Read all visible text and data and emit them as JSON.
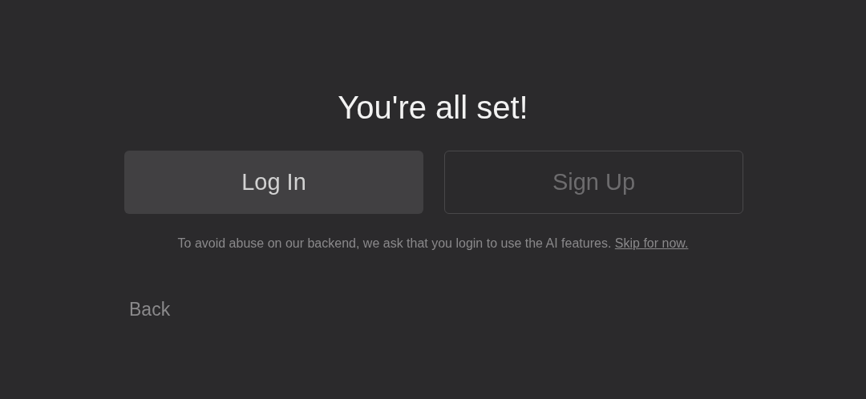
{
  "title": "You're all set!",
  "buttons": [
    {
      "label": "Log In",
      "kind": "primary"
    },
    {
      "label": "Sign Up",
      "kind": "outline"
    }
  ],
  "notice": {
    "text": "To avoid abuse on our backend, we ask that you login to use the AI features.",
    "link": "Skip for now."
  },
  "back": "Back"
}
